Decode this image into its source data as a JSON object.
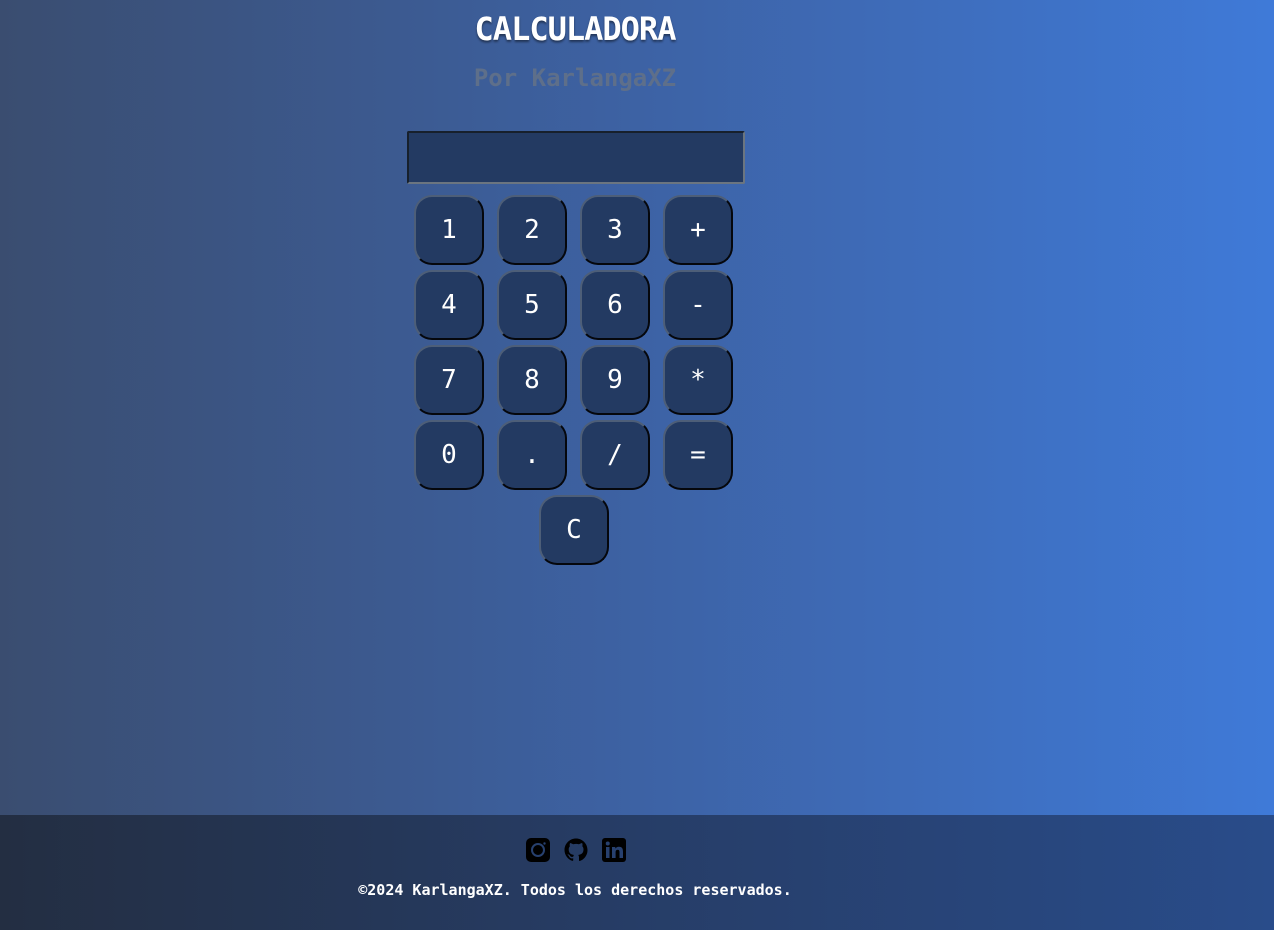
{
  "header": {
    "title": "CALCULADORA",
    "subtitle": "Por KarlangaXZ"
  },
  "calculator": {
    "display_value": "",
    "keys": [
      "1",
      "2",
      "3",
      "+",
      "4",
      "5",
      "6",
      "-",
      "7",
      "8",
      "9",
      "*",
      "0",
      ".",
      "/",
      "=",
      "C"
    ]
  },
  "footer": {
    "social_icons": [
      "instagram-icon",
      "github-icon",
      "linkedin-icon"
    ],
    "copyright": "©2024 KarlangaXZ. Todos los derechos reservados."
  },
  "colors": {
    "key_background": "#233a62",
    "footer_background": "#27406e",
    "subtitle_color": "#5e6f8a"
  }
}
